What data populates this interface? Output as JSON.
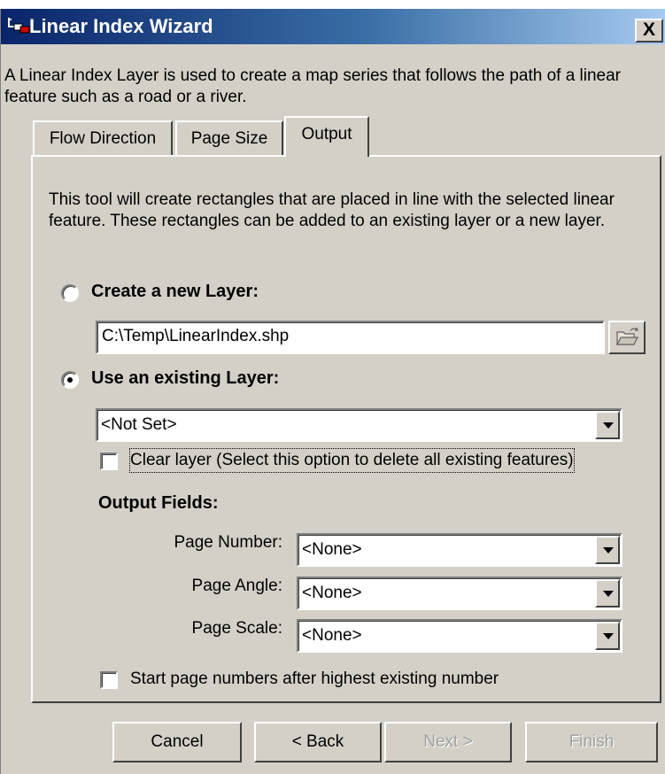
{
  "window": {
    "title": "Linear Index Wizard",
    "app_icon": "linear-index-icon",
    "close_label": "X"
  },
  "intro": "A Linear Index Layer is used to create a map series that follows the path of a linear feature such as a road or a river.",
  "tabs": [
    {
      "label": "Flow Direction",
      "active": false
    },
    {
      "label": "Page Size",
      "active": false
    },
    {
      "label": "Output",
      "active": true
    }
  ],
  "output": {
    "description": "This tool will create rectangles that are placed in line with the selected linear feature.  These rectangles can be added to an existing layer or a new layer.",
    "new_layer": {
      "label": "Create a new Layer:",
      "selected": false,
      "path": "C:\\Temp\\LinearIndex.shp",
      "browse_icon": "open-folder-icon"
    },
    "existing_layer": {
      "label": "Use an existing Layer:",
      "selected": true,
      "value": "<Not Set>",
      "clear_label": "Clear layer (Select this option to delete all existing features)",
      "clear_checked": false
    },
    "fields_heading": "Output Fields:",
    "fields": [
      {
        "label": "Page Number:",
        "value": "<None>"
      },
      {
        "label": "Page Angle:",
        "value": "<None>"
      },
      {
        "label": "Page Scale:",
        "value": "<None>"
      }
    ],
    "start_numbers_label": "Start page numbers after highest existing number",
    "start_numbers_checked": false
  },
  "buttons": {
    "cancel": "Cancel",
    "back": "< Back",
    "next": "Next >",
    "finish": "Finish"
  },
  "colors": {
    "dialog_face": "#d4d0c8",
    "title_start": "#0a246a",
    "title_end": "#a6caf0",
    "disabled_text": "#a0a0a0"
  }
}
